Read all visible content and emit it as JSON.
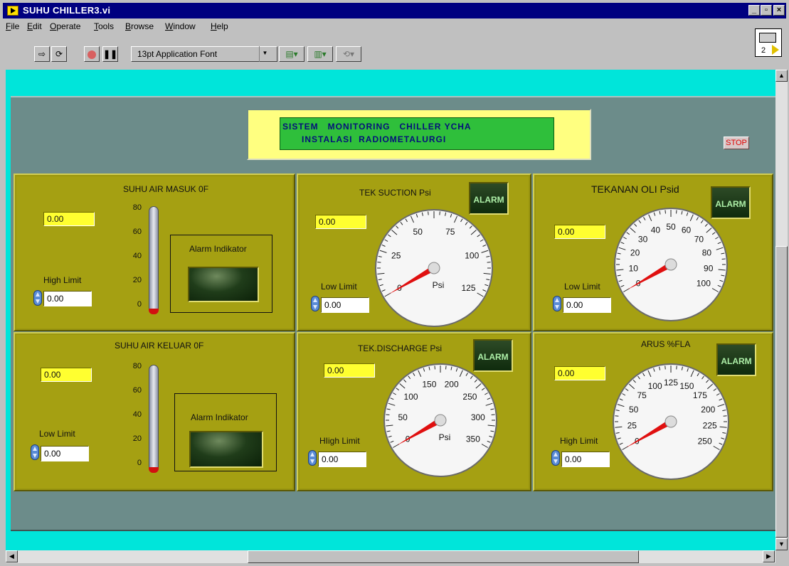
{
  "window": {
    "title": "SUHU CHILLER3.vi",
    "min_label": "_",
    "max_label": "▫",
    "close_label": "×"
  },
  "menu": [
    "File",
    "Edit",
    "Operate",
    "Tools",
    "Browse",
    "Window",
    "Help"
  ],
  "toolbar": {
    "font": "13pt Application Font",
    "vi_number": "2"
  },
  "header": {
    "line1": "SISTEM   MONITORING   CHILLER YCHA",
    "line2": "INSTALASI  RADIOMETALURGI",
    "stop_label": "STOP"
  },
  "colors": {
    "panel_bg": "#00e5da",
    "frame": "#6c8c8a",
    "section": "#a5a012",
    "indicator": "#ffff30",
    "title_box": "#ffff80",
    "title_inner": "#2fbf3b",
    "needle": "#e01010"
  },
  "sections": {
    "suhu_masuk": {
      "title": "SUHU AIR MASUK  0F",
      "value": "0.00",
      "limit_label": "High Limit",
      "limit_value": "0.00",
      "indicator_label": "Alarm Indikator",
      "thermo_ticks": [
        "80",
        "60",
        "40",
        "20",
        "0"
      ],
      "level": 0
    },
    "suhu_keluar": {
      "title": "SUHU AIR KELUAR 0F",
      "value": "0.00",
      "limit_label": "Low Limit",
      "limit_value": "0.00",
      "indicator_label": "Alarm Indikator",
      "thermo_ticks": [
        "80",
        "60",
        "40",
        "20",
        "0"
      ],
      "level": 0
    },
    "tek_suction": {
      "title": "TEK SUCTION Psi",
      "value": "0.00",
      "limit_label": "Low Limit",
      "limit_value": "0.00",
      "alarm_label": "ALARM",
      "unit": "Psi",
      "dial_labels": [
        "0",
        "25",
        "50",
        "75",
        "100",
        "125"
      ],
      "dial_max": 125,
      "reading": 0
    },
    "tekanan_oli": {
      "title": "TEKANAN OLI Psid",
      "value": "0.00",
      "limit_label": "Low Limit",
      "limit_value": "0.00",
      "alarm_label": "ALARM",
      "dial_labels": [
        "0",
        "10",
        "20",
        "30",
        "40",
        "50",
        "60",
        "70",
        "80",
        "90",
        "100"
      ],
      "dial_max": 100,
      "reading": 0
    },
    "tek_discharge": {
      "title": "TEK.DISCHARGE Psi",
      "value": "0.00",
      "limit_label": "HIigh Limit",
      "limit_value": "0.00",
      "alarm_label": "ALARM",
      "unit": "Psi",
      "dial_labels": [
        "0",
        "50",
        "100",
        "150",
        "200",
        "250",
        "300",
        "350"
      ],
      "dial_max": 350,
      "reading": 0
    },
    "arus_fla": {
      "title": "ARUS %FLA",
      "value": "0.00",
      "limit_label": "High Limit",
      "limit_value": "0.00",
      "alarm_label": "ALARM",
      "dial_labels": [
        "0",
        "25",
        "50",
        "75",
        "100",
        "125",
        "150",
        "175",
        "200",
        "225",
        "250"
      ],
      "dial_max": 250,
      "reading": 0
    }
  }
}
